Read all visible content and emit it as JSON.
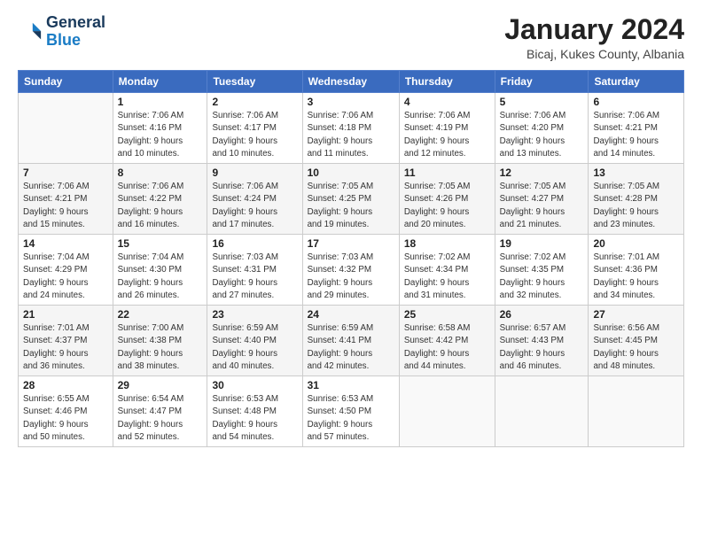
{
  "header": {
    "logo_line1": "General",
    "logo_line2": "Blue",
    "month_title": "January 2024",
    "location": "Bicaj, Kukes County, Albania"
  },
  "weekdays": [
    "Sunday",
    "Monday",
    "Tuesday",
    "Wednesday",
    "Thursday",
    "Friday",
    "Saturday"
  ],
  "weeks": [
    [
      {
        "day": "",
        "info": ""
      },
      {
        "day": "1",
        "info": "Sunrise: 7:06 AM\nSunset: 4:16 PM\nDaylight: 9 hours\nand 10 minutes."
      },
      {
        "day": "2",
        "info": "Sunrise: 7:06 AM\nSunset: 4:17 PM\nDaylight: 9 hours\nand 10 minutes."
      },
      {
        "day": "3",
        "info": "Sunrise: 7:06 AM\nSunset: 4:18 PM\nDaylight: 9 hours\nand 11 minutes."
      },
      {
        "day": "4",
        "info": "Sunrise: 7:06 AM\nSunset: 4:19 PM\nDaylight: 9 hours\nand 12 minutes."
      },
      {
        "day": "5",
        "info": "Sunrise: 7:06 AM\nSunset: 4:20 PM\nDaylight: 9 hours\nand 13 minutes."
      },
      {
        "day": "6",
        "info": "Sunrise: 7:06 AM\nSunset: 4:21 PM\nDaylight: 9 hours\nand 14 minutes."
      }
    ],
    [
      {
        "day": "7",
        "info": ""
      },
      {
        "day": "8",
        "info": "Sunrise: 7:06 AM\nSunset: 4:22 PM\nDaylight: 9 hours\nand 16 minutes."
      },
      {
        "day": "9",
        "info": "Sunrise: 7:06 AM\nSunset: 4:24 PM\nDaylight: 9 hours\nand 17 minutes."
      },
      {
        "day": "10",
        "info": "Sunrise: 7:05 AM\nSunset: 4:25 PM\nDaylight: 9 hours\nand 19 minutes."
      },
      {
        "day": "11",
        "info": "Sunrise: 7:05 AM\nSunset: 4:26 PM\nDaylight: 9 hours\nand 20 minutes."
      },
      {
        "day": "12",
        "info": "Sunrise: 7:05 AM\nSunset: 4:27 PM\nDaylight: 9 hours\nand 21 minutes."
      },
      {
        "day": "13",
        "info": "Sunrise: 7:05 AM\nSunset: 4:28 PM\nDaylight: 9 hours\nand 23 minutes."
      }
    ],
    [
      {
        "day": "14",
        "info": ""
      },
      {
        "day": "15",
        "info": "Sunrise: 7:04 AM\nSunset: 4:30 PM\nDaylight: 9 hours\nand 26 minutes."
      },
      {
        "day": "16",
        "info": "Sunrise: 7:03 AM\nSunset: 4:31 PM\nDaylight: 9 hours\nand 27 minutes."
      },
      {
        "day": "17",
        "info": "Sunrise: 7:03 AM\nSunset: 4:32 PM\nDaylight: 9 hours\nand 29 minutes."
      },
      {
        "day": "18",
        "info": "Sunrise: 7:02 AM\nSunset: 4:34 PM\nDaylight: 9 hours\nand 31 minutes."
      },
      {
        "day": "19",
        "info": "Sunrise: 7:02 AM\nSunset: 4:35 PM\nDaylight: 9 hours\nand 32 minutes."
      },
      {
        "day": "20",
        "info": "Sunrise: 7:01 AM\nSunset: 4:36 PM\nDaylight: 9 hours\nand 34 minutes."
      }
    ],
    [
      {
        "day": "21",
        "info": ""
      },
      {
        "day": "22",
        "info": "Sunrise: 7:00 AM\nSunset: 4:38 PM\nDaylight: 9 hours\nand 38 minutes."
      },
      {
        "day": "23",
        "info": "Sunrise: 6:59 AM\nSunset: 4:40 PM\nDaylight: 9 hours\nand 40 minutes."
      },
      {
        "day": "24",
        "info": "Sunrise: 6:59 AM\nSunset: 4:41 PM\nDaylight: 9 hours\nand 42 minutes."
      },
      {
        "day": "25",
        "info": "Sunrise: 6:58 AM\nSunset: 4:42 PM\nDaylight: 9 hours\nand 44 minutes."
      },
      {
        "day": "26",
        "info": "Sunrise: 6:57 AM\nSunset: 4:43 PM\nDaylight: 9 hours\nand 46 minutes."
      },
      {
        "day": "27",
        "info": "Sunrise: 6:56 AM\nSunset: 4:45 PM\nDaylight: 9 hours\nand 48 minutes."
      }
    ],
    [
      {
        "day": "28",
        "info": "Sunrise: 6:55 AM\nSunset: 4:46 PM\nDaylight: 9 hours\nand 50 minutes."
      },
      {
        "day": "29",
        "info": "Sunrise: 6:54 AM\nSunset: 4:47 PM\nDaylight: 9 hours\nand 52 minutes."
      },
      {
        "day": "30",
        "info": "Sunrise: 6:53 AM\nSunset: 4:48 PM\nDaylight: 9 hours\nand 54 minutes."
      },
      {
        "day": "31",
        "info": "Sunrise: 6:53 AM\nSunset: 4:50 PM\nDaylight: 9 hours\nand 57 minutes."
      },
      {
        "day": "",
        "info": ""
      },
      {
        "day": "",
        "info": ""
      },
      {
        "day": "",
        "info": ""
      }
    ]
  ],
  "week7_sunday": {
    "day": "7",
    "info": "Sunrise: 7:06 AM\nSunset: 4:21 PM\nDaylight: 9 hours\nand 15 minutes."
  },
  "week14_sunday": {
    "day": "14",
    "info": "Sunrise: 7:04 AM\nSunset: 4:29 PM\nDaylight: 9 hours\nand 24 minutes."
  },
  "week21_sunday": {
    "day": "21",
    "info": "Sunrise: 7:01 AM\nSunset: 4:37 PM\nDaylight: 9 hours\nand 36 minutes."
  }
}
